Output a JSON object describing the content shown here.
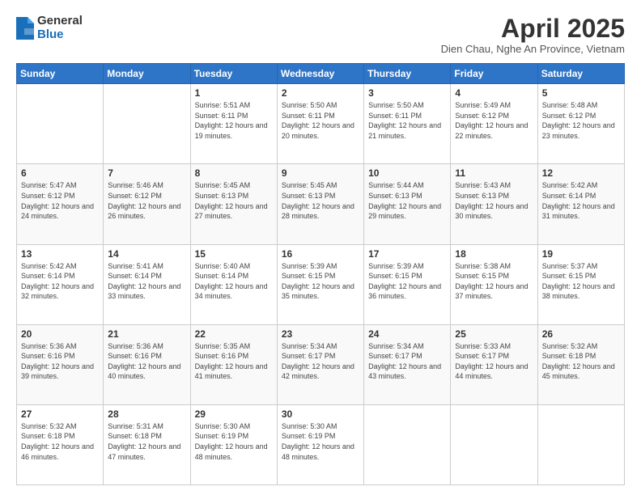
{
  "logo": {
    "general": "General",
    "blue": "Blue"
  },
  "title": {
    "month": "April 2025",
    "location": "Dien Chau, Nghe An Province, Vietnam"
  },
  "days_of_week": [
    "Sunday",
    "Monday",
    "Tuesday",
    "Wednesday",
    "Thursday",
    "Friday",
    "Saturday"
  ],
  "weeks": [
    [
      {
        "day": "",
        "info": ""
      },
      {
        "day": "",
        "info": ""
      },
      {
        "day": "1",
        "info": "Sunrise: 5:51 AM\nSunset: 6:11 PM\nDaylight: 12 hours and 19 minutes."
      },
      {
        "day": "2",
        "info": "Sunrise: 5:50 AM\nSunset: 6:11 PM\nDaylight: 12 hours and 20 minutes."
      },
      {
        "day": "3",
        "info": "Sunrise: 5:50 AM\nSunset: 6:11 PM\nDaylight: 12 hours and 21 minutes."
      },
      {
        "day": "4",
        "info": "Sunrise: 5:49 AM\nSunset: 6:12 PM\nDaylight: 12 hours and 22 minutes."
      },
      {
        "day": "5",
        "info": "Sunrise: 5:48 AM\nSunset: 6:12 PM\nDaylight: 12 hours and 23 minutes."
      }
    ],
    [
      {
        "day": "6",
        "info": "Sunrise: 5:47 AM\nSunset: 6:12 PM\nDaylight: 12 hours and 24 minutes."
      },
      {
        "day": "7",
        "info": "Sunrise: 5:46 AM\nSunset: 6:12 PM\nDaylight: 12 hours and 26 minutes."
      },
      {
        "day": "8",
        "info": "Sunrise: 5:45 AM\nSunset: 6:13 PM\nDaylight: 12 hours and 27 minutes."
      },
      {
        "day": "9",
        "info": "Sunrise: 5:45 AM\nSunset: 6:13 PM\nDaylight: 12 hours and 28 minutes."
      },
      {
        "day": "10",
        "info": "Sunrise: 5:44 AM\nSunset: 6:13 PM\nDaylight: 12 hours and 29 minutes."
      },
      {
        "day": "11",
        "info": "Sunrise: 5:43 AM\nSunset: 6:13 PM\nDaylight: 12 hours and 30 minutes."
      },
      {
        "day": "12",
        "info": "Sunrise: 5:42 AM\nSunset: 6:14 PM\nDaylight: 12 hours and 31 minutes."
      }
    ],
    [
      {
        "day": "13",
        "info": "Sunrise: 5:42 AM\nSunset: 6:14 PM\nDaylight: 12 hours and 32 minutes."
      },
      {
        "day": "14",
        "info": "Sunrise: 5:41 AM\nSunset: 6:14 PM\nDaylight: 12 hours and 33 minutes."
      },
      {
        "day": "15",
        "info": "Sunrise: 5:40 AM\nSunset: 6:14 PM\nDaylight: 12 hours and 34 minutes."
      },
      {
        "day": "16",
        "info": "Sunrise: 5:39 AM\nSunset: 6:15 PM\nDaylight: 12 hours and 35 minutes."
      },
      {
        "day": "17",
        "info": "Sunrise: 5:39 AM\nSunset: 6:15 PM\nDaylight: 12 hours and 36 minutes."
      },
      {
        "day": "18",
        "info": "Sunrise: 5:38 AM\nSunset: 6:15 PM\nDaylight: 12 hours and 37 minutes."
      },
      {
        "day": "19",
        "info": "Sunrise: 5:37 AM\nSunset: 6:15 PM\nDaylight: 12 hours and 38 minutes."
      }
    ],
    [
      {
        "day": "20",
        "info": "Sunrise: 5:36 AM\nSunset: 6:16 PM\nDaylight: 12 hours and 39 minutes."
      },
      {
        "day": "21",
        "info": "Sunrise: 5:36 AM\nSunset: 6:16 PM\nDaylight: 12 hours and 40 minutes."
      },
      {
        "day": "22",
        "info": "Sunrise: 5:35 AM\nSunset: 6:16 PM\nDaylight: 12 hours and 41 minutes."
      },
      {
        "day": "23",
        "info": "Sunrise: 5:34 AM\nSunset: 6:17 PM\nDaylight: 12 hours and 42 minutes."
      },
      {
        "day": "24",
        "info": "Sunrise: 5:34 AM\nSunset: 6:17 PM\nDaylight: 12 hours and 43 minutes."
      },
      {
        "day": "25",
        "info": "Sunrise: 5:33 AM\nSunset: 6:17 PM\nDaylight: 12 hours and 44 minutes."
      },
      {
        "day": "26",
        "info": "Sunrise: 5:32 AM\nSunset: 6:18 PM\nDaylight: 12 hours and 45 minutes."
      }
    ],
    [
      {
        "day": "27",
        "info": "Sunrise: 5:32 AM\nSunset: 6:18 PM\nDaylight: 12 hours and 46 minutes."
      },
      {
        "day": "28",
        "info": "Sunrise: 5:31 AM\nSunset: 6:18 PM\nDaylight: 12 hours and 47 minutes."
      },
      {
        "day": "29",
        "info": "Sunrise: 5:30 AM\nSunset: 6:19 PM\nDaylight: 12 hours and 48 minutes."
      },
      {
        "day": "30",
        "info": "Sunrise: 5:30 AM\nSunset: 6:19 PM\nDaylight: 12 hours and 48 minutes."
      },
      {
        "day": "",
        "info": ""
      },
      {
        "day": "",
        "info": ""
      },
      {
        "day": "",
        "info": ""
      }
    ]
  ]
}
